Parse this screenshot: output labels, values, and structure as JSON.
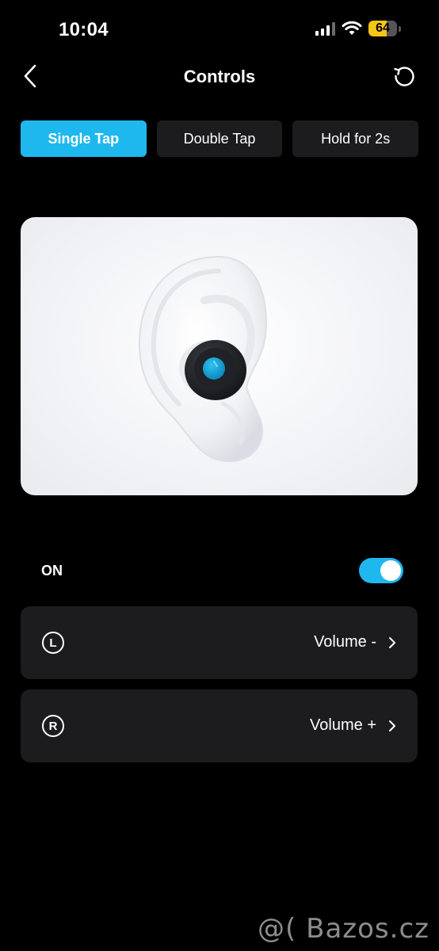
{
  "status_bar": {
    "time": "10:04",
    "battery_level": "64",
    "battery_percent": 64,
    "signal_icon": "cellular-signal-icon",
    "wifi_icon": "wifi-icon",
    "battery_color": "#f5c518"
  },
  "header": {
    "title": "Controls",
    "back_icon": "chevron-left-icon",
    "reset_icon": "reset-icon"
  },
  "tabs": [
    {
      "label": "Single Tap",
      "active": true
    },
    {
      "label": "Double Tap",
      "active": false
    },
    {
      "label": "Hold for 2s",
      "active": false
    }
  ],
  "illustration": {
    "icon": "ear-with-earbud-illustration"
  },
  "toggle_row": {
    "label": "ON",
    "enabled": true
  },
  "controls": [
    {
      "side": "L",
      "value": "Volume -",
      "icon": "chevron-right-icon"
    },
    {
      "side": "R",
      "value": "Volume +",
      "icon": "chevron-right-icon"
    }
  ],
  "watermark": {
    "text": "@( Bazos.cz"
  },
  "colors": {
    "accent": "#1fb8ee",
    "background": "#000000",
    "card": "#1c1c1e",
    "battery": "#f5c518"
  }
}
